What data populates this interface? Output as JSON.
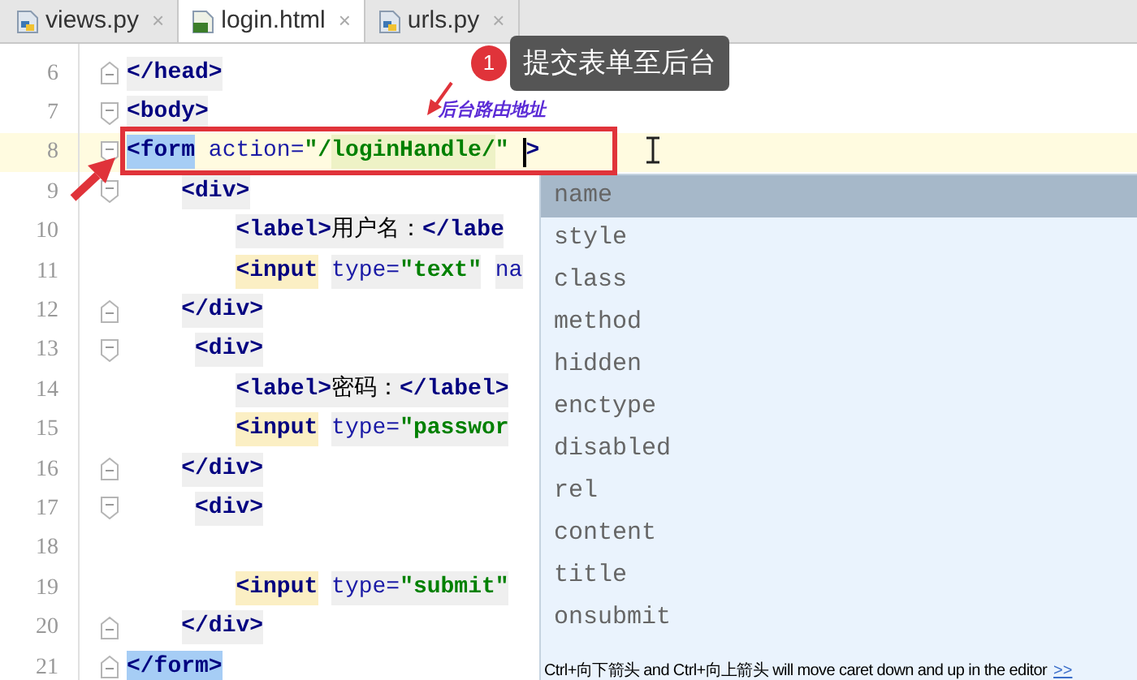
{
  "tabs": [
    {
      "label": "views.py",
      "kind": "python",
      "close": "×",
      "selected": false
    },
    {
      "label": "login.html",
      "kind": "html",
      "close": "×",
      "selected": true
    },
    {
      "label": "urls.py",
      "kind": "python",
      "close": "×",
      "selected": false
    }
  ],
  "callout": {
    "badge": "1",
    "text": "提交表单至后台"
  },
  "annotation": "后台路由地址",
  "lines": [
    {
      "number": "6",
      "fold_start": false,
      "fold_end": true,
      "current": false,
      "tokens": [
        {
          "text": "</head>",
          "kind": "tag",
          "matched": false
        }
      ]
    },
    {
      "number": "7",
      "fold_start": true,
      "fold_end": false,
      "current": false,
      "tokens": [
        {
          "text": "<body>",
          "kind": "tag",
          "matched": false
        }
      ]
    },
    {
      "number": "8",
      "fold_start": true,
      "fold_end": false,
      "current": true,
      "tokens": [
        {
          "text": "<form",
          "kind": "tag",
          "matched": true
        },
        {
          "text": " action=",
          "kind": "attr",
          "matched": false
        },
        {
          "text": "\"/",
          "kind": "value",
          "matched": false
        },
        {
          "text": "loginHandle/",
          "kind": "path",
          "matched": false
        },
        {
          "text": "\" ",
          "kind": "value",
          "matched": false
        },
        {
          "text": ">",
          "kind": "tag",
          "matched": false,
          "caret_before": true
        }
      ]
    },
    {
      "number": "9",
      "fold_start": true,
      "fold_end": false,
      "current": false,
      "tokens": [
        {
          "text": "    <div>",
          "kind": "tag",
          "matched": false
        }
      ]
    },
    {
      "number": "10",
      "fold_start": false,
      "fold_end": false,
      "current": false,
      "tokens": [
        {
          "text": "        <label>",
          "kind": "tag",
          "matched": false
        },
        {
          "text": "用户名：",
          "kind": "text",
          "matched": false
        },
        {
          "text": "</labe",
          "kind": "tag",
          "matched": false
        }
      ]
    },
    {
      "number": "11",
      "fold_start": false,
      "fold_end": false,
      "current": false,
      "tokens": [
        {
          "text": "        <input",
          "kind": "keyword",
          "matched": false
        },
        {
          "text": " type=",
          "kind": "attr",
          "matched": false
        },
        {
          "text": "\"text\"",
          "kind": "value",
          "matched": false
        },
        {
          "text": " na",
          "kind": "attr",
          "matched": false
        }
      ]
    },
    {
      "number": "12",
      "fold_start": false,
      "fold_end": true,
      "current": false,
      "tokens": [
        {
          "text": "    </div>",
          "kind": "tag",
          "matched": false
        }
      ]
    },
    {
      "number": "13",
      "fold_start": true,
      "fold_end": false,
      "current": false,
      "tokens": [
        {
          "text": "     <div>",
          "kind": "tag",
          "matched": false
        }
      ]
    },
    {
      "number": "14",
      "fold_start": false,
      "fold_end": false,
      "current": false,
      "tokens": [
        {
          "text": "        <label>",
          "kind": "tag",
          "matched": false
        },
        {
          "text": "密码：",
          "kind": "text",
          "matched": false
        },
        {
          "text": "</label>",
          "kind": "tag",
          "matched": false
        }
      ]
    },
    {
      "number": "15",
      "fold_start": false,
      "fold_end": false,
      "current": false,
      "tokens": [
        {
          "text": "        <input",
          "kind": "keyword",
          "matched": false
        },
        {
          "text": " type=",
          "kind": "attr",
          "matched": false
        },
        {
          "text": "\"passwor",
          "kind": "value",
          "matched": false
        }
      ]
    },
    {
      "number": "16",
      "fold_start": false,
      "fold_end": true,
      "current": false,
      "tokens": [
        {
          "text": "    </div>",
          "kind": "tag",
          "matched": false
        }
      ]
    },
    {
      "number": "17",
      "fold_start": true,
      "fold_end": false,
      "current": false,
      "tokens": [
        {
          "text": "     <div>",
          "kind": "tag",
          "matched": false
        }
      ]
    },
    {
      "number": "18",
      "fold_start": false,
      "fold_end": false,
      "current": false
    },
    {
      "number": "19",
      "fold_start": false,
      "fold_end": false,
      "current": false,
      "tokens": [
        {
          "text": "        <input",
          "kind": "keyword",
          "matched": false
        },
        {
          "text": " type=",
          "kind": "attr",
          "matched": false
        },
        {
          "text": "\"submit\"",
          "kind": "value",
          "matched": false
        }
      ]
    },
    {
      "number": "20",
      "fold_start": false,
      "fold_end": true,
      "current": false,
      "tokens": [
        {
          "text": "    </div>",
          "kind": "tag",
          "matched": false
        }
      ]
    },
    {
      "number": "21",
      "fold_start": false,
      "fold_end": true,
      "current": false,
      "tokens": [
        {
          "text": "</form>",
          "kind": "tag",
          "matched": true
        }
      ]
    }
  ],
  "completion": {
    "items": [
      {
        "label": "name",
        "selected": true
      },
      {
        "label": "style",
        "selected": false
      },
      {
        "label": "class",
        "selected": false
      },
      {
        "label": "method",
        "selected": false
      },
      {
        "label": "hidden",
        "selected": false
      },
      {
        "label": "enctype",
        "selected": false
      },
      {
        "label": "disabled",
        "selected": false
      },
      {
        "label": "rel",
        "selected": false
      },
      {
        "label": "content",
        "selected": false
      },
      {
        "label": "title",
        "selected": false
      },
      {
        "label": "onsubmit",
        "selected": false
      }
    ],
    "hint": "Ctrl+向下箭头 and Ctrl+向上箭头 will move caret down and up in the editor",
    "hint_link": ">>"
  }
}
